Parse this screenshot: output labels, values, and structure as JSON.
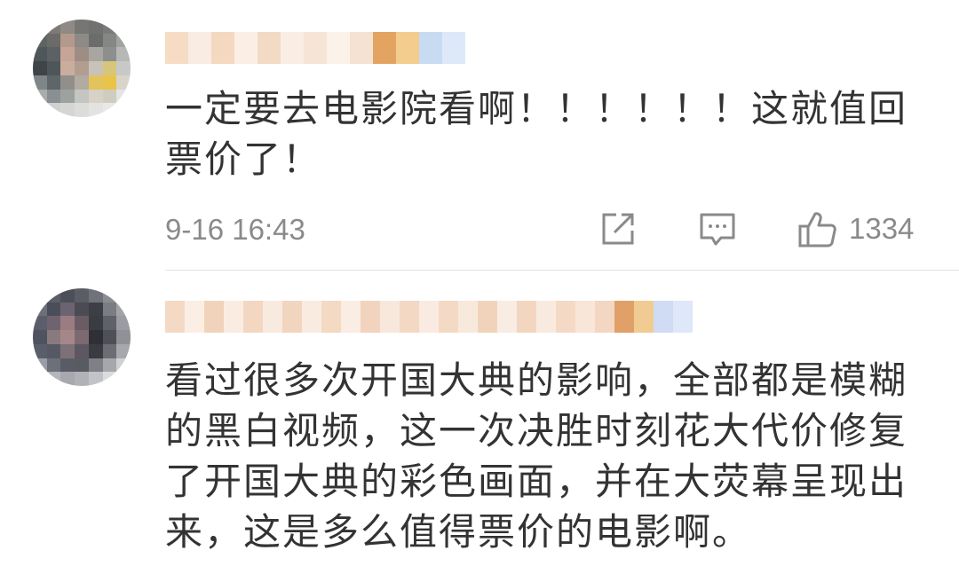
{
  "comments": [
    {
      "username": "",
      "text": "一定要去电影院看啊！！！！！！这就值回票价了！",
      "time": "9-16 16:43",
      "likes": "1334"
    },
    {
      "username": "",
      "text": "看过很多次开国大典的影响，全部都是模糊的黑白视频，这一次决胜时刻花大代价修复了开国大典的彩色画面，并在大荧幕呈现出来，这是多么值得票价的电影啊。"
    }
  ],
  "icons": {
    "share": "share-icon",
    "reply": "comment-icon",
    "like": "thumbs-up-icon"
  },
  "colors": {
    "text": "#333333",
    "meta": "#8a8a8a",
    "divider": "#e2e2e2"
  }
}
